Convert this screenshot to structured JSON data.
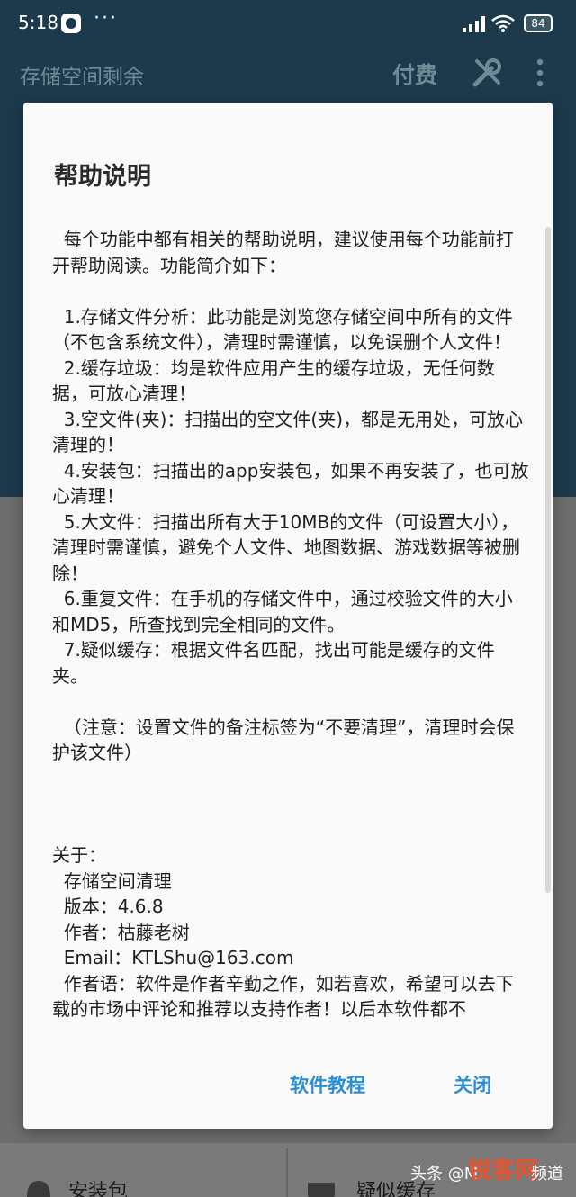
{
  "statusbar": {
    "time": "5:18",
    "dots": "···",
    "battery": "84"
  },
  "appbar": {
    "title": "存储空间剩余",
    "pay_label": "付费"
  },
  "dialog": {
    "title": "帮助说明",
    "content": "  每个功能中都有相关的帮助说明，建议使用每个功能前打开帮助阅读。功能简介如下：\n\n  1.存储文件分析：此功能是浏览您存储空间中所有的文件（不包含系统文件），清理时需谨慎，以免误删个人文件！\n  2.缓存垃圾：均是软件应用产生的缓存垃圾，无任何数据，可放心清理！\n  3.空文件(夹)：扫描出的空文件(夹)，都是无用处，可放心清理的！\n  4.安装包：扫描出的app安装包，如果不再安装了，也可放心清理！\n  5.大文件：扫描出所有大于10MB的文件（可设置大小），清理时需谨慎，避免个人文件、地图数据、游戏数据等被删除！\n  6.重复文件：在手机的存储文件中，通过校验文件的大小和MD5，所查找到完全相同的文件。\n  7.疑似缓存：根据文件名匹配，找出可能是缓存的文件夹。\n\n  （注意：设置文件的备注标签为“不要清理”，清理时会保护该文件）\n\n\n\n关于：\n  存储空间清理\n  版本：4.6.8\n  作者：枯藤老树\n  Email：KTLShu@163.com\n  作者语：软件是作者辛勤之作，如若喜欢，希望可以去下载的市场中评论和推荐以支持作者！以后本软件都不",
    "btn_tutorial": "软件教程",
    "btn_close": "关闭"
  },
  "background": {
    "item_left": "安装包",
    "item_right": "疑似缓存"
  },
  "watermark": {
    "text": "头条 @M",
    "logo": "锐客网",
    "suffix": "频道"
  },
  "colors": {
    "accent": "#2b8ed4",
    "appbar": "#1c3a4c",
    "dialog_bg": "#fafafa"
  }
}
